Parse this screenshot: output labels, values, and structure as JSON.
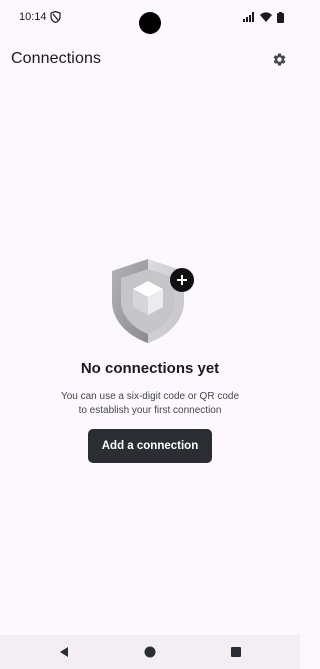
{
  "status_bar": {
    "time": "10:14",
    "icons": [
      "shield-status-icon",
      "signal-icon",
      "wifi-icon",
      "battery-icon"
    ]
  },
  "header": {
    "title": "Connections",
    "settings_icon": "gear-icon"
  },
  "empty_state": {
    "illustration": "shield-with-plus-badge",
    "title": "No connections yet",
    "description_line1": "You can use a six-digit code or QR code",
    "description_line2": "to establish your first connection",
    "button_label": "Add a connection"
  },
  "navigation": {
    "buttons": [
      "back-icon",
      "home-icon",
      "recents-icon"
    ]
  },
  "colors": {
    "background": "#fdf8fd",
    "button": "#2b2d33",
    "button_text": "#ffffff",
    "nav_bar": "#f2eef2"
  }
}
